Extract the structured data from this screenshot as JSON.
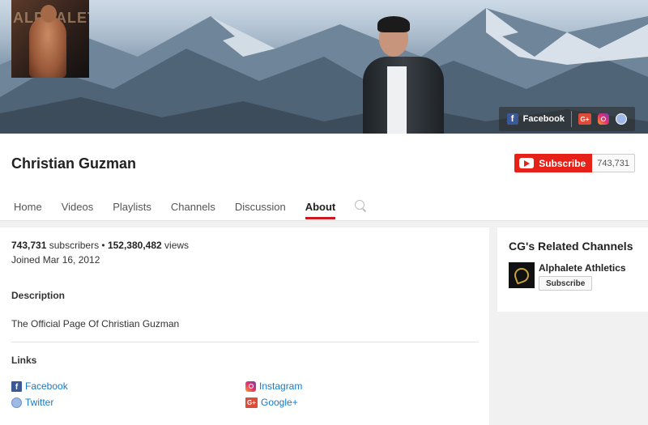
{
  "banner": {
    "avatar_text": "ALPHALETE",
    "social_links": [
      {
        "label": "Facebook",
        "icon": "facebook-icon"
      },
      {
        "label": "",
        "icon": "google-plus-icon"
      },
      {
        "label": "",
        "icon": "instagram-icon"
      },
      {
        "label": "",
        "icon": "globe-icon"
      }
    ],
    "gplus_glyph": "G+",
    "fb_glyph": "f"
  },
  "channel": {
    "name": "Christian Guzman",
    "subscribe_label": "Subscribe",
    "subscriber_count": "743,731"
  },
  "tabs": [
    {
      "label": "Home"
    },
    {
      "label": "Videos"
    },
    {
      "label": "Playlists"
    },
    {
      "label": "Channels"
    },
    {
      "label": "Discussion"
    },
    {
      "label": "About",
      "active": true
    }
  ],
  "about": {
    "subscribers": "743,731",
    "subscribers_word": " subscribers • ",
    "views": "152,380,482",
    "views_word": " views",
    "joined": "Joined Mar 16, 2012",
    "description_heading": "Description",
    "description_text": "The Official Page Of Christian Guzman",
    "links_heading": "Links",
    "links": [
      {
        "label": "Facebook",
        "icon": "facebook-icon"
      },
      {
        "label": "Twitter",
        "icon": "twitter-icon"
      },
      {
        "label": "Instagram",
        "icon": "instagram-icon"
      },
      {
        "label": "Google+",
        "icon": "google-plus-icon"
      }
    ]
  },
  "related": {
    "title": "CG's Related Channels",
    "channels": [
      {
        "name": "Alphalete Athletics",
        "subscribe_label": "Subscribe"
      }
    ]
  },
  "colors": {
    "subscribe_red": "#e62117",
    "link_blue": "#167ac6",
    "active_tab_underline": "#cc181e"
  }
}
